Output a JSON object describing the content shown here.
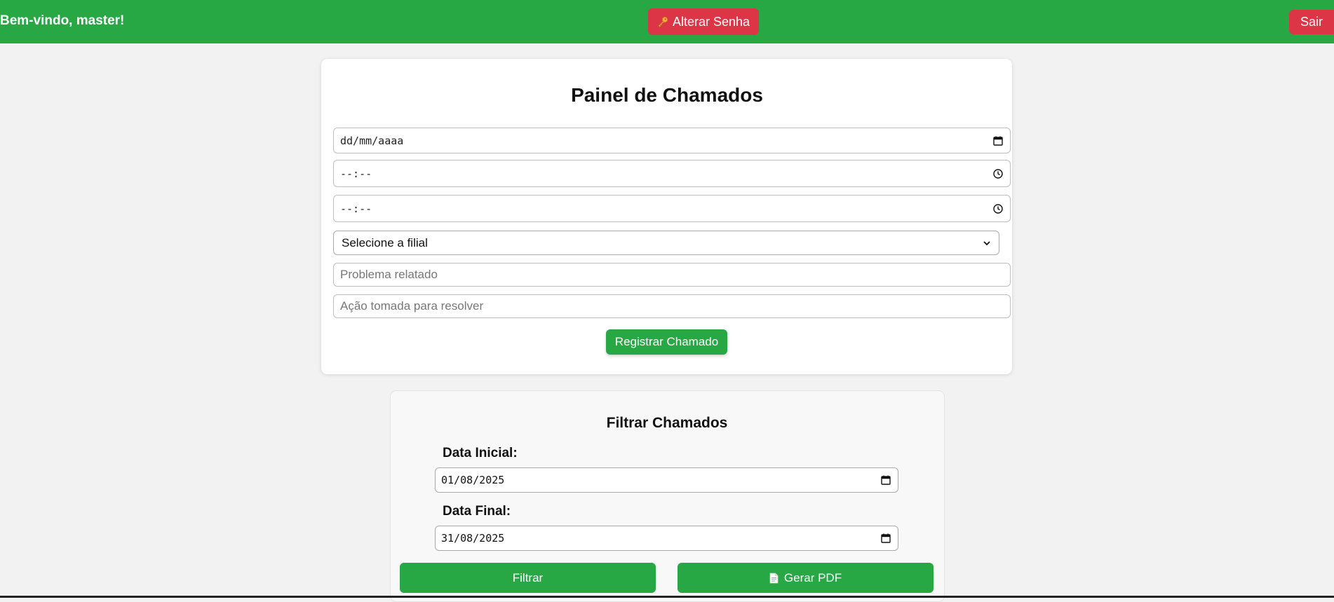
{
  "header": {
    "welcome": "Bem-vindo, master!",
    "change_password_label": "Alterar Senha",
    "logout_label": "Sair"
  },
  "register": {
    "title": "Painel de Chamados",
    "date_placeholder": "dd/mm/aaaa",
    "start_time_placeholder": "--:--",
    "end_time_placeholder": "--:--",
    "branch_select_value": "Selecione a filial",
    "problem_placeholder": "Problema relatado",
    "action_placeholder": "Ação tomada para resolver",
    "submit_label": "Registrar Chamado"
  },
  "filter": {
    "title": "Filtrar Chamados",
    "start_label": "Data Inicial:",
    "start_value": "01/08/2025",
    "end_label": "Data Final:",
    "end_value": "31/08/2025",
    "filter_label": "Filtrar",
    "pdf_label": "Gerar PDF"
  },
  "colors": {
    "header_green": "#28a745",
    "danger_red": "#dc3545",
    "background": "#f2f2f2"
  }
}
